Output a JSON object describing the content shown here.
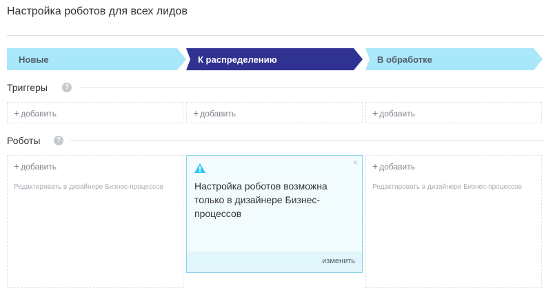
{
  "page": {
    "title": "Настройка роботов для всех лидов"
  },
  "stages": [
    {
      "label": "Новые"
    },
    {
      "label": "К распределению"
    },
    {
      "label": "В обработке"
    }
  ],
  "triggers": {
    "title": "Триггеры",
    "help_icon": "?",
    "add_label": "добавить"
  },
  "robots": {
    "title": "Роботы",
    "help_icon": "?",
    "add_label": "добавить",
    "hint": "Редактировать в дизайнере Бизнес-процессов"
  },
  "popup": {
    "message": "Настройка роботов возможна только в дизайнере Бизнес-процессов",
    "close": "×",
    "edit_label": "изменить",
    "icon": "warning-icon"
  },
  "colors": {
    "stage_light": "#a9e8fa",
    "stage_active": "#2f3290",
    "popup_border": "#8bd4e8",
    "warning": "#2fc6f6"
  }
}
